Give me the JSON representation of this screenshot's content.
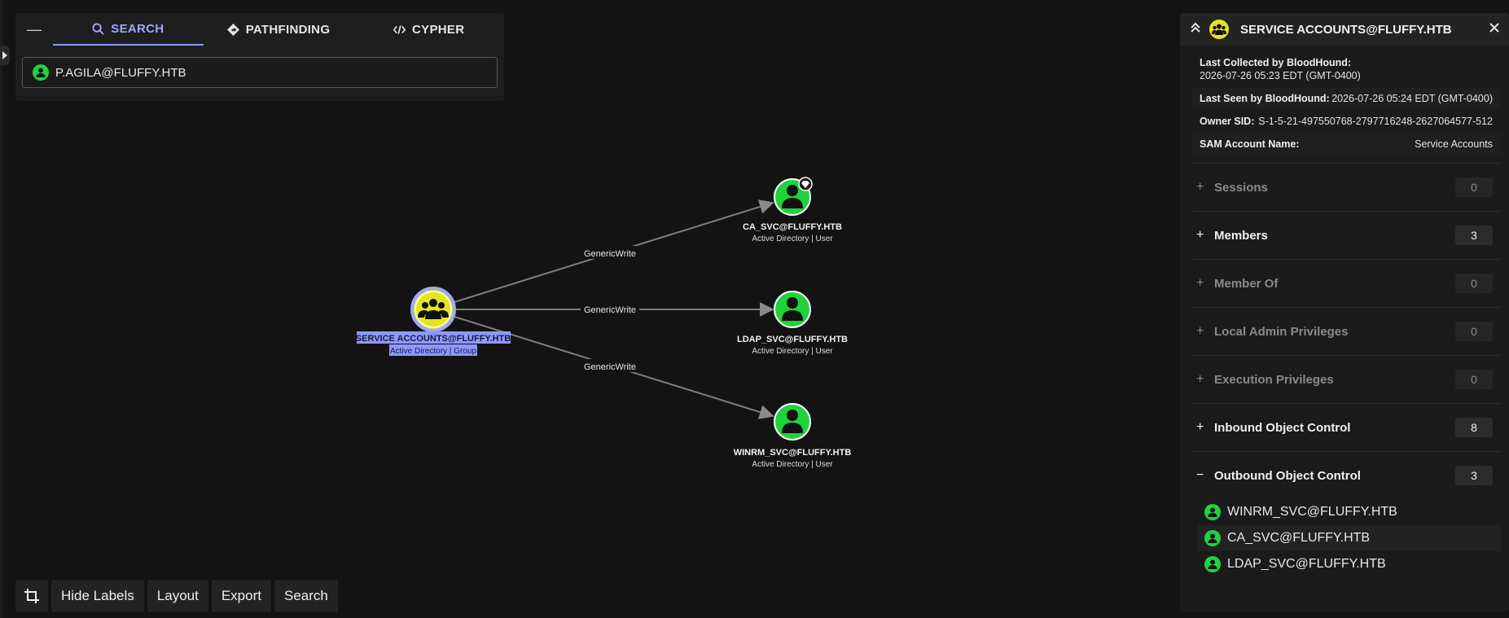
{
  "search_panel": {
    "tabs": [
      {
        "label": "SEARCH",
        "icon": "search-icon",
        "active": true
      },
      {
        "label": "PATHFINDING",
        "icon": "diamond-route-icon",
        "active": false
      },
      {
        "label": "CYPHER",
        "icon": "code-icon",
        "active": false
      }
    ],
    "search_value": "P.AGILA@FLUFFY.HTB"
  },
  "graph": {
    "nodes": [
      {
        "label": "SERVICE ACCOUNTS@FLUFFY.HTB",
        "sub": "Active Directory | Group",
        "type": "group",
        "color": "#e5e51f"
      },
      {
        "label": "CA_SVC@FLUFFY.HTB",
        "sub": "Active Directory | User",
        "type": "user",
        "color": "#1fd33d"
      },
      {
        "label": "LDAP_SVC@FLUFFY.HTB",
        "sub": "Active Directory | User",
        "type": "user",
        "color": "#1fd33d"
      },
      {
        "label": "WINRM_SVC@FLUFFY.HTB",
        "sub": "Active Directory | User",
        "type": "user",
        "color": "#1fd33d"
      }
    ],
    "edges": [
      {
        "label": "GenericWrite"
      },
      {
        "label": "GenericWrite"
      },
      {
        "label": "GenericWrite"
      }
    ]
  },
  "toolbar": {
    "hide_labels": "Hide Labels",
    "layout": "Layout",
    "export": "Export",
    "search": "Search"
  },
  "details": {
    "title": "SERVICE ACCOUNTS@FLUFFY.HTB",
    "props": {
      "last_collected_key": "Last Collected by BloodHound:",
      "last_collected_val": "2026-07-26 05:23 EDT (GMT-0400)",
      "last_seen_key": "Last Seen by BloodHound:",
      "last_seen_val": "2026-07-26 05:24 EDT (GMT-0400)",
      "owner_sid_key": "Owner SID:",
      "owner_sid_val": "S-1-5-21-497550768-2797716248-2627064577-512",
      "sam_key": "SAM Account Name:",
      "sam_val": "Service Accounts"
    },
    "sections": [
      {
        "sign": "+",
        "name": "Sessions",
        "count": "0",
        "enabled": false
      },
      {
        "sign": "+",
        "name": "Members",
        "count": "3",
        "enabled": true
      },
      {
        "sign": "+",
        "name": "Member Of",
        "count": "0",
        "enabled": false
      },
      {
        "sign": "+",
        "name": "Local Admin Privileges",
        "count": "0",
        "enabled": false
      },
      {
        "sign": "+",
        "name": "Execution Privileges",
        "count": "0",
        "enabled": false
      },
      {
        "sign": "+",
        "name": "Inbound Object Control",
        "count": "8",
        "enabled": true
      },
      {
        "sign": "−",
        "name": "Outbound Object Control",
        "count": "3",
        "enabled": true
      }
    ],
    "outbound": [
      "WINRM_SVC@FLUFFY.HTB",
      "CA_SVC@FLUFFY.HTB",
      "LDAP_SVC@FLUFFY.HTB"
    ]
  },
  "colors": {
    "accent": "#8f98ff",
    "user": "#1fd33d",
    "group": "#e5e51f",
    "background": "#131313"
  }
}
